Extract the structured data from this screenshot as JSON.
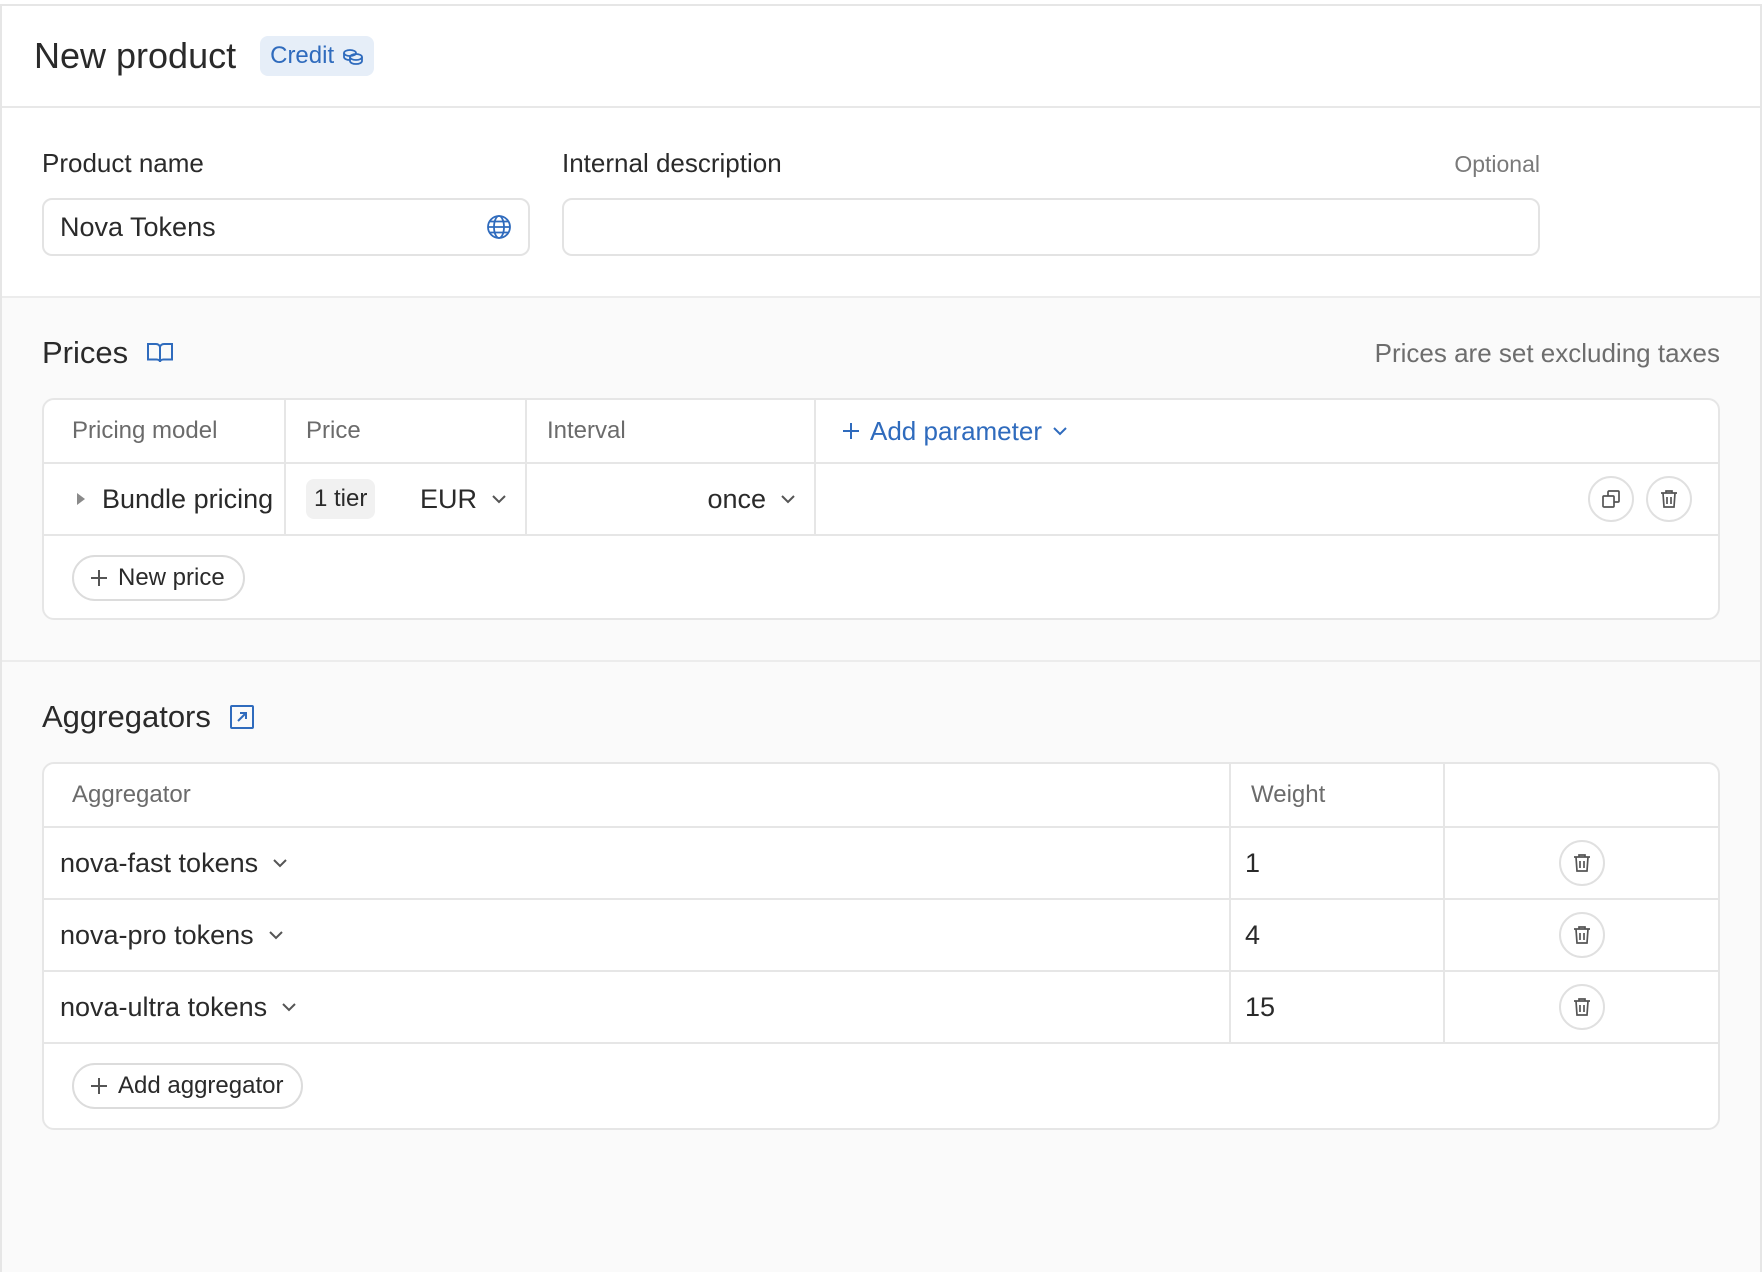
{
  "header": {
    "title": "New product",
    "badge_label": "Credit",
    "badge_icon": "coins-icon"
  },
  "form": {
    "product_name_label": "Product name",
    "product_name_value": "Nova Tokens",
    "product_name_icon": "globe-icon",
    "internal_description_label": "Internal description",
    "internal_description_optional": "Optional",
    "internal_description_value": ""
  },
  "prices": {
    "title": "Prices",
    "title_icon": "book-icon",
    "note": "Prices are set excluding taxes",
    "columns": [
      "Pricing model",
      "Price",
      "Interval"
    ],
    "add_parameter_label": "Add parameter",
    "rows": [
      {
        "pricing_model": "Bundle pricing",
        "tier": "1 tier",
        "currency": "EUR",
        "interval": "once"
      }
    ],
    "new_price_label": "New price"
  },
  "aggregators": {
    "title": "Aggregators",
    "title_icon": "external-link-icon",
    "columns": [
      "Aggregator",
      "Weight"
    ],
    "rows": [
      {
        "name": "nova-fast tokens",
        "weight": "1"
      },
      {
        "name": "nova-pro tokens",
        "weight": "4"
      },
      {
        "name": "nova-ultra tokens",
        "weight": "15"
      }
    ],
    "add_label": "Add aggregator"
  },
  "colors": {
    "accent": "#2f6bbd",
    "badge_bg": "#e6eef8",
    "border": "#e6e6e6"
  }
}
